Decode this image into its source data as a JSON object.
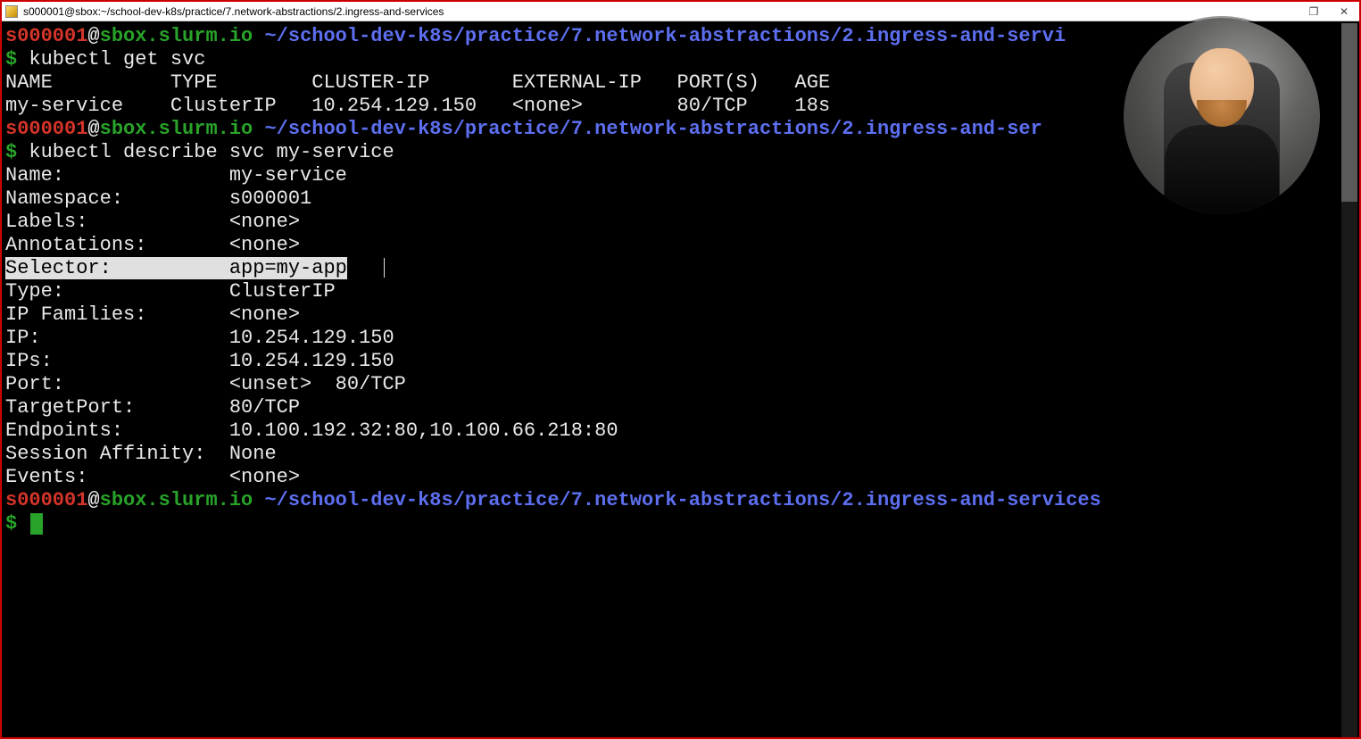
{
  "window": {
    "title": "s000001@sbox:~/school-dev-k8s/practice/7.network-abstractions/2.ingress-and-services"
  },
  "prompt": {
    "user": "s000001",
    "at": "@",
    "host": "sbox.slurm.io",
    "path_full": "~/school-dev-k8s/practice/7.network-abstractions/2.ingress-and-services",
    "path_trunc1": "~/school-dev-k8s/practice/7.network-abstractions/2.ingress-and-servi",
    "path_trunc2": "~/school-dev-k8s/practice/7.network-abstractions/2.ingress-and-ser",
    "symbol": "$"
  },
  "commands": {
    "get_svc": "kubectl get svc",
    "describe_svc": "kubectl describe svc my-service"
  },
  "svc_table": {
    "header": "NAME          TYPE        CLUSTER-IP       EXTERNAL-IP   PORT(S)   AGE",
    "row1": "my-service    ClusterIP   10.254.129.150   <none>        80/TCP    18s"
  },
  "describe": {
    "name": {
      "label": "Name:",
      "value": "my-service"
    },
    "namespace": {
      "label": "Namespace:",
      "value": "s000001"
    },
    "labels": {
      "label": "Labels:",
      "value": "<none>"
    },
    "annotations": {
      "label": "Annotations:",
      "value": "<none>"
    },
    "selector": {
      "label": "Selector:",
      "value": "app=my-app"
    },
    "type": {
      "label": "Type:",
      "value": "ClusterIP"
    },
    "ipfamilies": {
      "label": "IP Families:",
      "value": "<none>"
    },
    "ip": {
      "label": "IP:",
      "value": "10.254.129.150"
    },
    "ips": {
      "label": "IPs:",
      "value": "10.254.129.150"
    },
    "port": {
      "label": "Port:",
      "value": "<unset>  80/TCP"
    },
    "targetport": {
      "label": "TargetPort:",
      "value": "80/TCP"
    },
    "endpoints": {
      "label": "Endpoints:",
      "value": "10.100.192.32:80,10.100.66.218:80"
    },
    "session": {
      "label": "Session Affinity:",
      "value": "None"
    },
    "events": {
      "label": "Events:",
      "value": "<none>"
    }
  },
  "label_width": 19
}
